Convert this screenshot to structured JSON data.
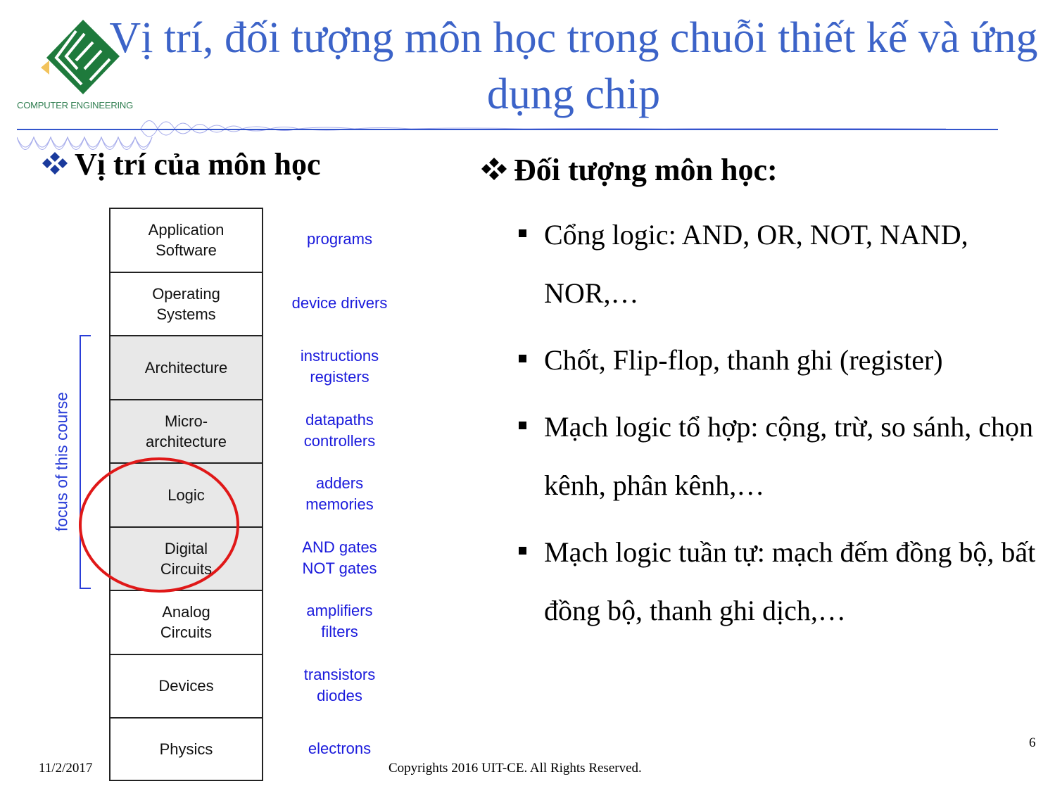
{
  "logo": {
    "caption": "COMPUTER ENGINEERING",
    "colors": {
      "green": "#1e7a3c",
      "accent": "#f2c35c"
    }
  },
  "title": "Vị trí, đối tượng môn học trong chuỗi thiết kế và ứng dụng chip",
  "title_color": "#3c63c8",
  "left_section": {
    "heading": "Vị trí của môn học",
    "bullet_icon": "diamond-cluster-icon",
    "bullet_color": "#1a3a9c",
    "focus_label": "focus of this course",
    "highlight": "Logic / Digital Circuits",
    "layers": [
      {
        "name": "Application\nSoftware",
        "example": "programs",
        "in_focus": false
      },
      {
        "name": "Operating\nSystems",
        "example": "device drivers",
        "in_focus": false
      },
      {
        "name": "Architecture",
        "example": "instructions\nregisters",
        "in_focus": true
      },
      {
        "name": "Micro-\narchitecture",
        "example": "datapaths\ncontrollers",
        "in_focus": true
      },
      {
        "name": "Logic",
        "example": "adders\nmemories",
        "in_focus": true
      },
      {
        "name": "Digital\nCircuits",
        "example": "AND gates\nNOT gates",
        "in_focus": true
      },
      {
        "name": "Analog\nCircuits",
        "example": "amplifiers\nfilters",
        "in_focus": false
      },
      {
        "name": "Devices",
        "example": "transistors\ndiodes",
        "in_focus": false
      },
      {
        "name": "Physics",
        "example": "electrons",
        "in_focus": false
      }
    ]
  },
  "right_section": {
    "heading": "Đối tượng môn học:",
    "bullet_icon": "diamond-cluster-icon",
    "items": [
      "Cổng logic: AND, OR, NOT, NAND, NOR,…",
      "Chốt, Flip-flop, thanh ghi (register)",
      "Mạch logic tổ hợp: cộng, trừ, so sánh, chọn kênh, phân kênh,…",
      "Mạch logic tuần tự: mạch đếm đồng bộ, bất đồng bộ, thanh ghi dịch,…"
    ]
  },
  "footer": {
    "date": "11/2/2017",
    "copyright": "Copyrights 2016 UIT-CE. All Rights Reserved.",
    "page_number": "6"
  }
}
